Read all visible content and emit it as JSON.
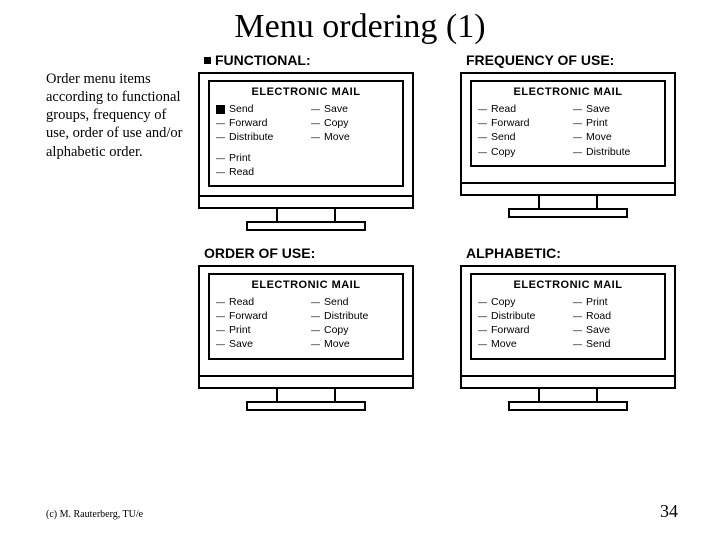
{
  "title": "Menu ordering (1)",
  "sidebar_text": "Order menu items according to functional groups, frequency of use, order of use and/or alphabetic order.",
  "screen_title": "ELECTRONIC MAIL",
  "quads": {
    "functional": {
      "label": "FUNCTIONAL:",
      "left": [
        "Send",
        "Forward",
        "Distribute"
      ],
      "right": [
        "Save",
        "Copy",
        "Move"
      ],
      "extra": [
        "Print",
        "Read"
      ]
    },
    "frequency": {
      "label": "FREQUENCY OF USE:",
      "left": [
        "Read",
        "Forward",
        "Send",
        "Copy"
      ],
      "right": [
        "Save",
        "Print",
        "Move",
        "Distribute"
      ]
    },
    "orderofuse": {
      "label": "ORDER OF USE:",
      "left": [
        "Read",
        "Forward",
        "Print",
        "Save"
      ],
      "right": [
        "Send",
        "Distribute",
        "Copy",
        "Move"
      ]
    },
    "alphabetic": {
      "label": "ALPHABETIC:",
      "left": [
        "Copy",
        "Distribute",
        "Forward",
        "Move"
      ],
      "right": [
        "Print",
        "Road",
        "Save",
        "Send"
      ]
    }
  },
  "footer_left": "(c) M. Rauterberg, TU/e",
  "footer_right": "34"
}
